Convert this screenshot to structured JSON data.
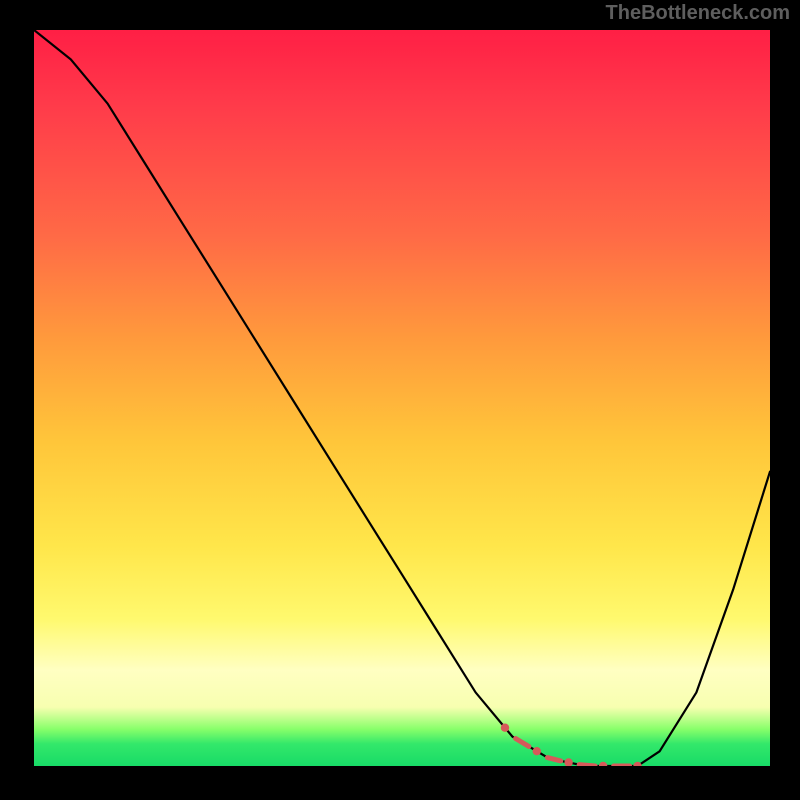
{
  "watermark": "TheBottleneck.com",
  "chart_data": {
    "type": "line",
    "title": "",
    "xlabel": "",
    "ylabel": "",
    "xlim": [
      0,
      100
    ],
    "ylim": [
      0,
      100
    ],
    "x": [
      0,
      5,
      10,
      15,
      20,
      25,
      30,
      35,
      40,
      45,
      50,
      55,
      60,
      65,
      70,
      75,
      80,
      82,
      85,
      90,
      95,
      100
    ],
    "values": [
      100,
      96,
      90,
      82,
      74,
      66,
      58,
      50,
      42,
      34,
      26,
      18,
      10,
      4,
      1,
      0,
      0,
      0,
      2,
      10,
      24,
      40
    ],
    "marker_region_x": [
      64,
      82
    ],
    "background_gradient": {
      "direction": "top-to-bottom",
      "stops": [
        {
          "pos": 0,
          "color": "#ff1f45"
        },
        {
          "pos": 28,
          "color": "#ff6a46"
        },
        {
          "pos": 56,
          "color": "#ffc63a"
        },
        {
          "pos": 80,
          "color": "#fff96e"
        },
        {
          "pos": 92,
          "color": "#f7ffb0"
        },
        {
          "pos": 97,
          "color": "#33e86a"
        },
        {
          "pos": 100,
          "color": "#18db67"
        }
      ]
    }
  }
}
